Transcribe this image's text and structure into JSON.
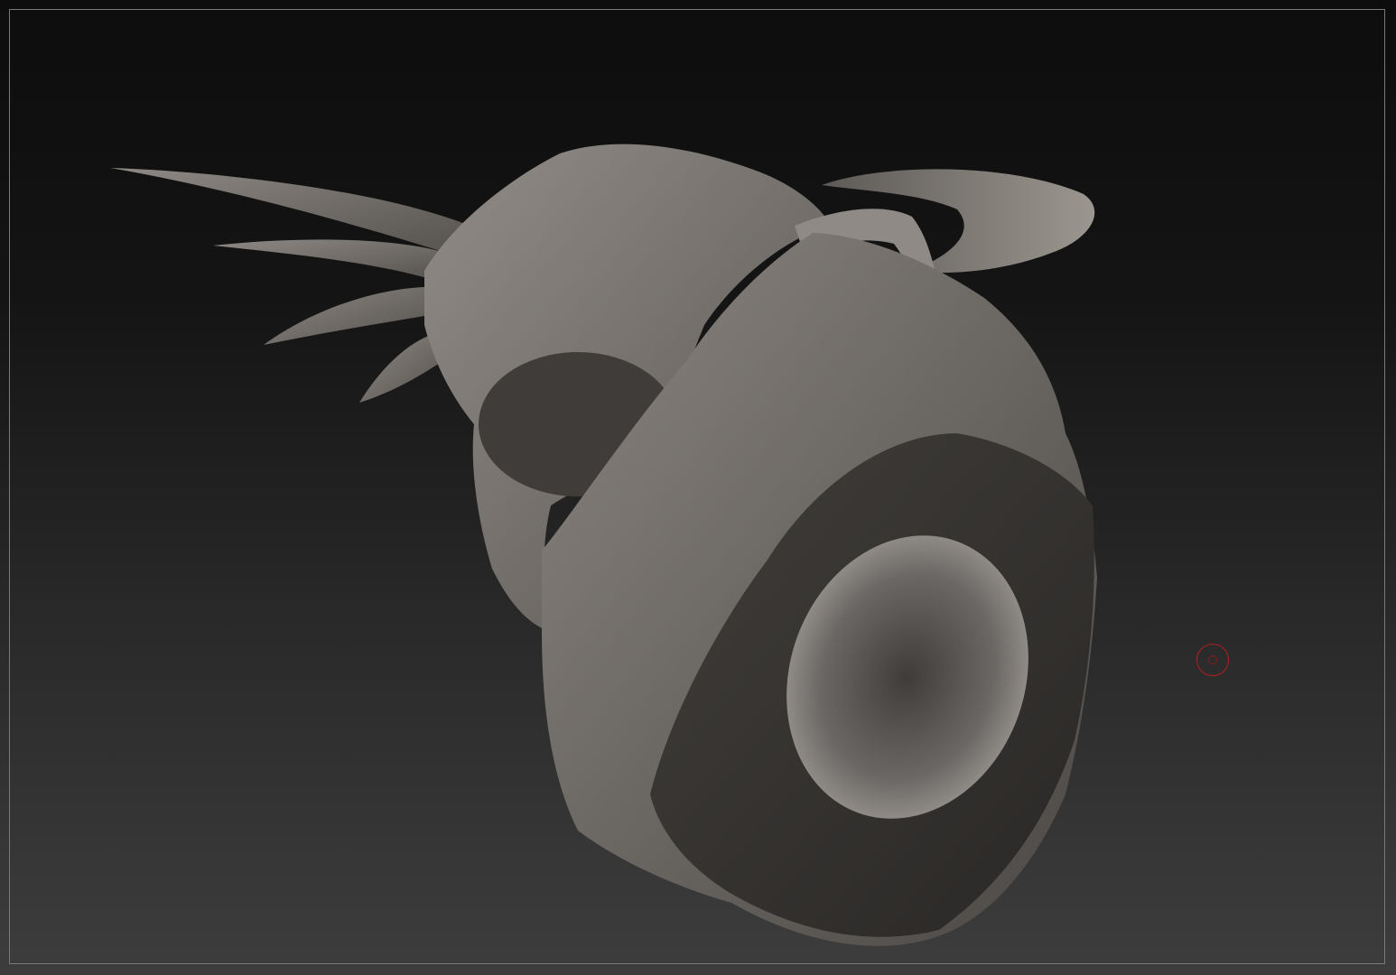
{
  "viewport": {
    "background_top": "#0d0d0d",
    "background_bottom": "#3d3d3d",
    "frame_color": "#7a7a7a"
  },
  "model": {
    "material_color": "#6e6a66",
    "highlight_color": "#9a958f",
    "shadow_color": "#2a2826"
  },
  "brush_cursor": {
    "color": "#b02020",
    "icon": "brush-cursor-icon"
  }
}
